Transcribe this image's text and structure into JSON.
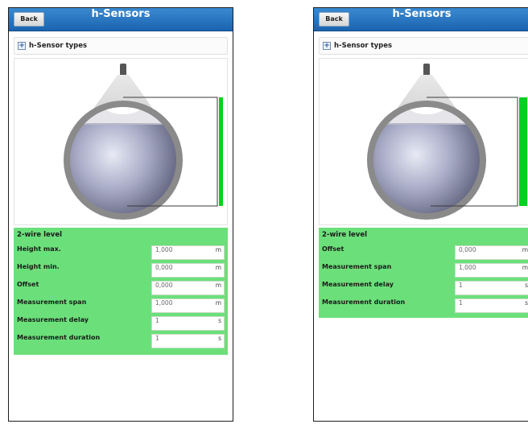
{
  "left": {
    "header": {
      "back_label": "Back",
      "title": "h-Sensors"
    },
    "sensor_types_label": "h-Sensor types",
    "panel_title": "2-wire level",
    "params": [
      {
        "label": "Height max.",
        "value": "1,000",
        "unit": "m"
      },
      {
        "label": "Height min.",
        "value": "0,000",
        "unit": "m"
      },
      {
        "label": "Offset",
        "value": "0,000",
        "unit": "m"
      },
      {
        "label": "Measurement span",
        "value": "1,000",
        "unit": "m"
      },
      {
        "label": "Measurement delay",
        "value": "1",
        "unit": "s"
      },
      {
        "label": "Measurement duration",
        "value": "1",
        "unit": "s"
      }
    ]
  },
  "right": {
    "header": {
      "back_label": "Back",
      "title": "h-Sensors"
    },
    "sensor_types_label": "h-Sensor types",
    "panel_title": "2-wire level",
    "params": [
      {
        "label": "Offset",
        "value": "0,000",
        "unit": "m"
      },
      {
        "label": "Measurement span",
        "value": "1,000",
        "unit": "m"
      },
      {
        "label": "Measurement delay",
        "value": "1",
        "unit": "s"
      },
      {
        "label": "Measurement duration",
        "value": "1",
        "unit": "s"
      }
    ]
  },
  "colors": {
    "header_blue": "#1b63b0",
    "panel_green": "#6be07a",
    "level_bar_green": "#00d21e"
  },
  "icons": [
    "plus-icon",
    "pipe-sensor-graphic"
  ]
}
